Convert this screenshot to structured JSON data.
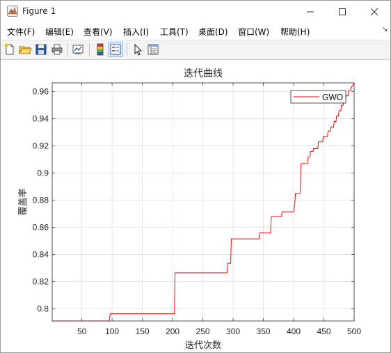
{
  "window": {
    "title": "Figure 1"
  },
  "menu": [
    "文件(F)",
    "编辑(E)",
    "查看(V)",
    "插入(I)",
    "工具(T)",
    "桌面(D)",
    "窗口(W)",
    "帮助(H)"
  ],
  "toolbar": {
    "items": [
      "new-figure-icon",
      "open-file-icon",
      "save-icon",
      "print-icon",
      "link-plot-icon",
      "colorbar-icon",
      "legend-icon",
      "edit-plot-arrow-icon",
      "property-inspector-icon"
    ]
  },
  "chart_data": {
    "type": "line",
    "title": "迭代曲线",
    "xlabel": "迭代次数",
    "ylabel": "覆盖率",
    "xlim": [
      1,
      500
    ],
    "ylim": [
      0.791,
      0.9665
    ],
    "xticks": [
      50,
      100,
      150,
      200,
      250,
      300,
      350,
      400,
      450,
      500
    ],
    "yticks": [
      0.8,
      0.82,
      0.84,
      0.86,
      0.88,
      0.9,
      0.92,
      0.94,
      0.96
    ],
    "grid": true,
    "legend": "top-right",
    "series": [
      {
        "name": "GWO",
        "color": "#ff0000",
        "x": [
          1,
          95,
          96,
          97,
          203,
          204,
          290,
          291,
          296,
          297,
          343,
          344,
          362,
          363,
          380,
          381,
          400,
          401,
          402,
          403,
          411,
          412,
          423,
          424,
          427,
          428,
          432,
          433,
          440,
          441,
          448,
          449,
          456,
          457,
          461,
          462,
          466,
          467,
          470,
          471,
          474,
          475,
          478,
          479,
          482,
          483,
          486,
          487,
          490,
          491,
          494,
          495,
          498,
          500
        ],
        "y": [
          0.791,
          0.791,
          0.793,
          0.7963,
          0.7963,
          0.8265,
          0.8265,
          0.8335,
          0.8335,
          0.8515,
          0.8515,
          0.856,
          0.856,
          0.868,
          0.868,
          0.8715,
          0.8715,
          0.8745,
          0.878,
          0.885,
          0.885,
          0.907,
          0.907,
          0.912,
          0.912,
          0.916,
          0.916,
          0.918,
          0.918,
          0.923,
          0.923,
          0.927,
          0.927,
          0.931,
          0.931,
          0.934,
          0.934,
          0.938,
          0.938,
          0.942,
          0.942,
          0.946,
          0.946,
          0.95,
          0.95,
          0.954,
          0.954,
          0.957,
          0.957,
          0.961,
          0.961,
          0.963,
          0.965,
          0.9665
        ]
      }
    ]
  }
}
